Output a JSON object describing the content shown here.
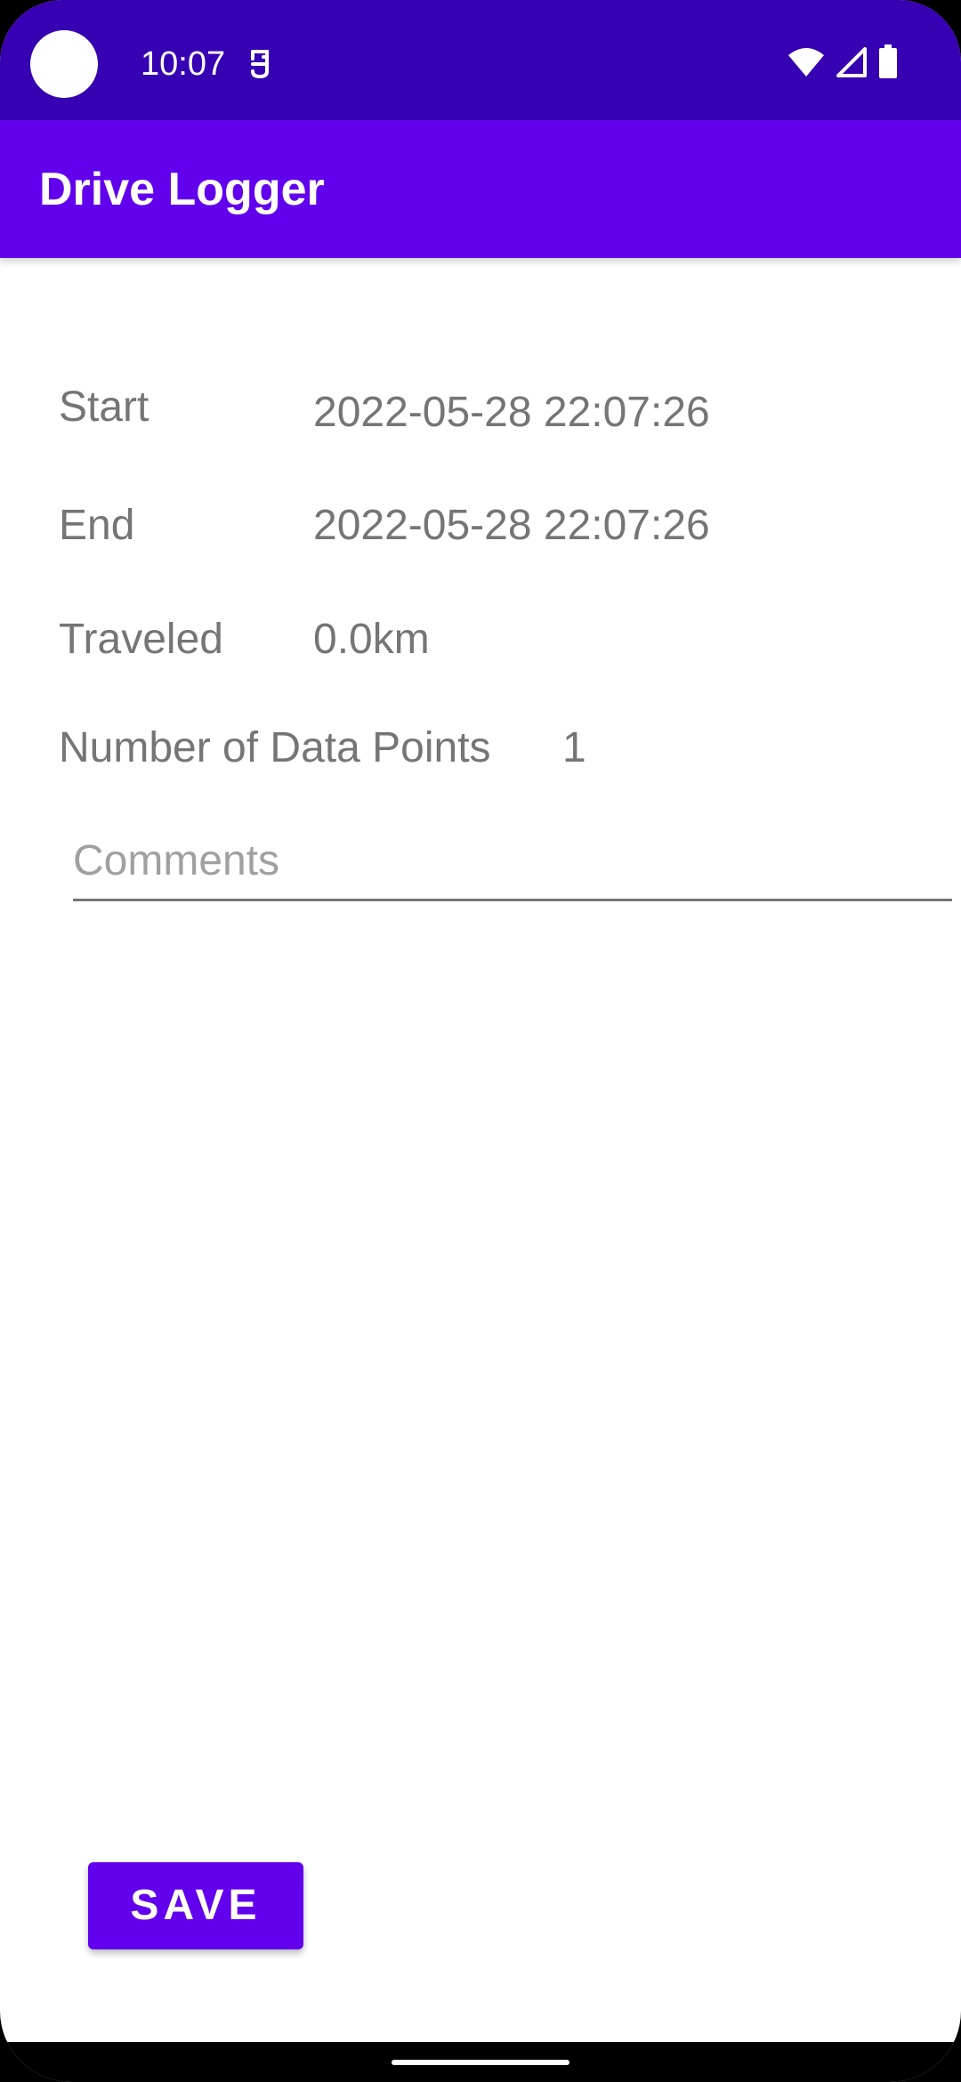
{
  "status_bar": {
    "time": "10:07",
    "icons": [
      "sim-card-icon",
      "wifi-icon",
      "cellular-signal-icon",
      "battery-icon"
    ],
    "background_color": "#3700b3"
  },
  "app_bar": {
    "title": "Drive Logger",
    "background_color": "#6200ee"
  },
  "trip": {
    "start_label": "Start",
    "start_value": "2022-05-28 22:07:26",
    "end_label": "End",
    "end_value": "2022-05-28 22:07:26",
    "traveled_label": "Traveled",
    "traveled_value": "0.0km",
    "data_points_label": "Number of Data Points",
    "data_points_value": "1"
  },
  "comments": {
    "placeholder": "Comments",
    "value": ""
  },
  "actions": {
    "save_label": "SAVE",
    "accent_color": "#6200ee"
  }
}
